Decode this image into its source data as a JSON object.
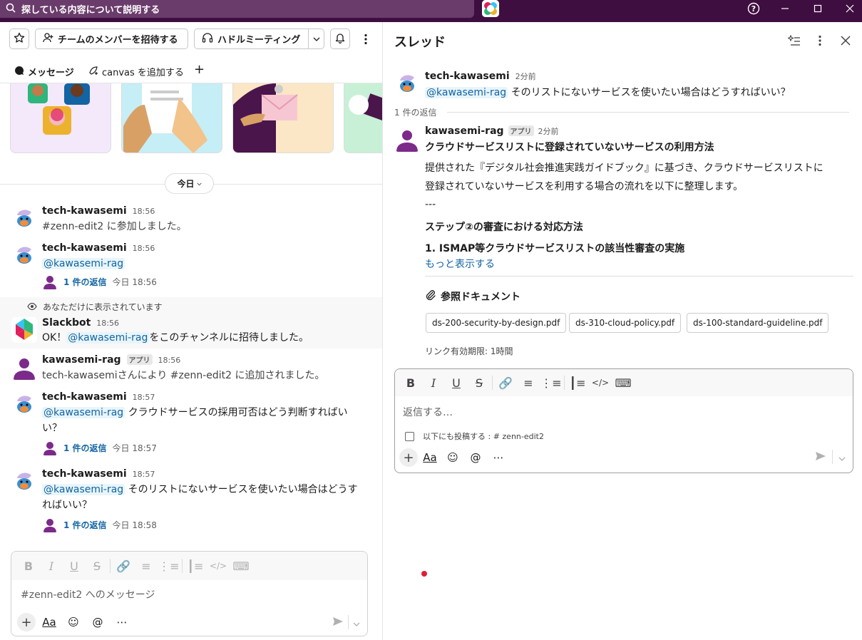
{
  "topbar": {
    "search_placeholder": "探している内容について説明する",
    "help_icon": "help-icon",
    "minimize_icon": "minimize-icon",
    "maximize_icon": "maximize-icon",
    "close_icon": "close-icon"
  },
  "channel_toolbar": {
    "invite_label": "チームのメンバーを招待する",
    "huddle_label": "ハドルミーティング"
  },
  "tabs": {
    "messages": "メッセージ",
    "add_canvas": "canvas を追加する"
  },
  "day_divider": "今日",
  "messages": [
    {
      "author": "tech-kawasemi",
      "time": "18:56",
      "text": "#zenn-edit2 に参加しました。"
    },
    {
      "author": "tech-kawasemi",
      "time": "18:56",
      "mention": "@kawasemi-rag",
      "reply_count": "1 件の返信",
      "reply_time": "今日 18:56"
    },
    {
      "ephemeral_note": "あなただけに表示されています",
      "author": "Slackbot",
      "time": "18:56",
      "pre": "OK！",
      "mention": "@kawasemi-rag",
      "text": "をこのチャンネルに招待しました。"
    },
    {
      "author": "kawasemi-rag",
      "badge": "アプリ",
      "time": "18:56",
      "text": "tech-kawasemiさんにより #zenn-edit2 に追加されました。"
    },
    {
      "author": "tech-kawasemi",
      "time": "18:57",
      "mention": "@kawasemi-rag",
      "text_line1": " クラウドサービスの採用可否はどう判断すればい",
      "text_line2": "い？",
      "reply_count": "1 件の返信",
      "reply_time": "今日 18:57"
    },
    {
      "author": "tech-kawasemi",
      "time": "18:57",
      "mention": "@kawasemi-rag",
      "text_line1": " そのリストにないサービスを使いたい場合はどうす",
      "text_line2": "ればいい？",
      "reply_count": "1 件の返信",
      "reply_time": "今日 18:58"
    }
  ],
  "composer": {
    "placeholder": "#zenn-edit2 へのメッセージ",
    "format_label": "Aa"
  },
  "thread": {
    "title": "スレッド",
    "root": {
      "author": "tech-kawasemi",
      "time": "2分前",
      "mention": "@kawasemi-rag",
      "text": " そのリストにないサービスを使いたい場合はどうすればいい？"
    },
    "reply_count_label": "1 件の返信",
    "reply": {
      "author": "kawasemi-rag",
      "badge": "アプリ",
      "time": "2分前",
      "heading": "クラウドサービスリストに登録されていないサービスの利用方法",
      "para_line1": "提供された『デジタル社会推進実践ガイドブック』に基づき、クラウドサービスリストに",
      "para_line2": "登録されていないサービスを利用する場合の流れを以下に整理します。",
      "separator": "---",
      "step_heading": "ステップ②の審査における対応方法",
      "step_item": "1. ISMAP等クラウドサービスリストの該当性審査の実施",
      "show_more": "もっと表示する",
      "docs_heading": "参照ドキュメント",
      "docs": [
        "ds-200-security-by-design.pdf",
        "ds-310-cloud-policy.pdf",
        "ds-100-standard-guideline.pdf"
      ],
      "link_expiry": "リンク有効期限: 1時間"
    },
    "composer": {
      "placeholder": "返信する…",
      "also_post": "以下にも投稿する : # zenn-edit2",
      "format_label": "Aa"
    }
  },
  "colors": {
    "titlebar": "#3f0e40",
    "mention": "#1264a3",
    "link": "#1264a3",
    "recording_dot": "#e01e38"
  }
}
